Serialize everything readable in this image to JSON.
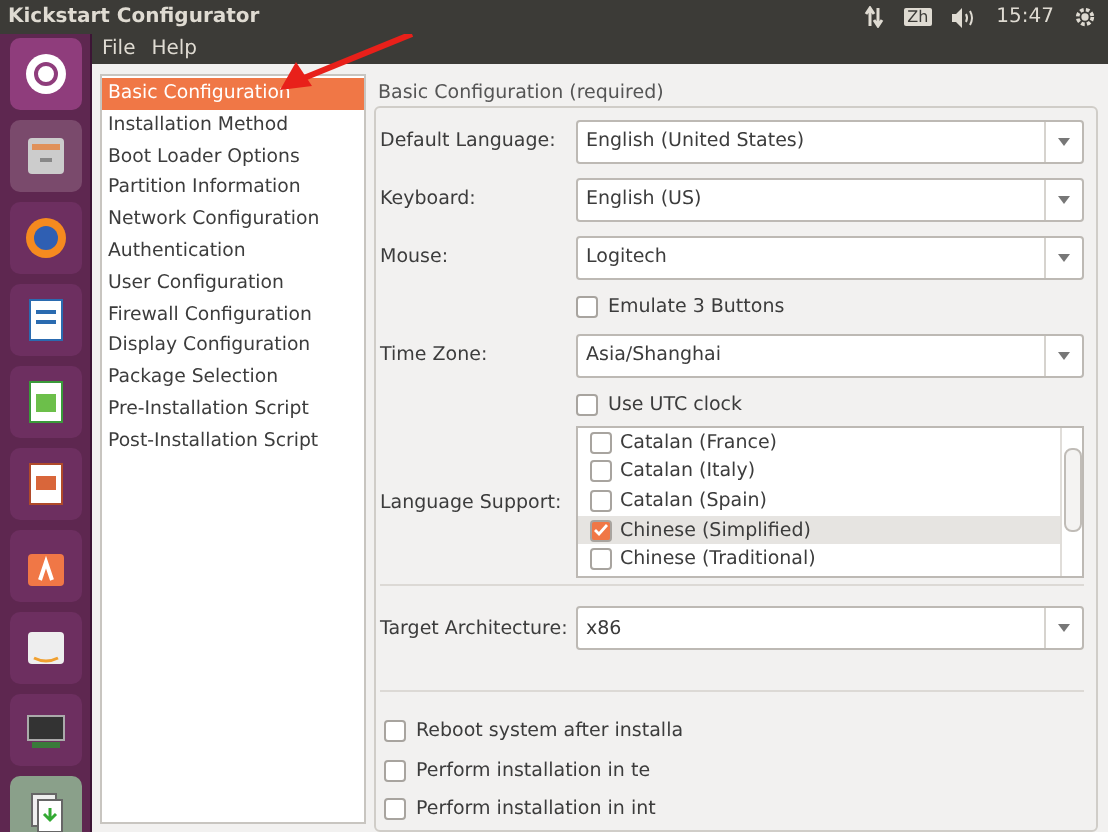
{
  "window": {
    "title": "Kickstart Configurator"
  },
  "panel": {
    "keyboard_layout": "Zh",
    "clock": "15:47"
  },
  "menu": [
    "File",
    "Help"
  ],
  "sidebar": {
    "items": [
      {
        "label": "Basic Configuration",
        "selected": true
      },
      {
        "label": "Installation Method",
        "selected": false
      },
      {
        "label": "Boot Loader Options",
        "selected": false
      },
      {
        "label": "Partition Information",
        "selected": false
      },
      {
        "label": "Network Configuration",
        "selected": false
      },
      {
        "label": "Authentication",
        "selected": false
      },
      {
        "label": "User Configuration",
        "selected": false
      },
      {
        "label": "Firewall Configuration",
        "selected": false
      },
      {
        "label": "Display Configuration",
        "selected": false
      },
      {
        "label": "Package Selection",
        "selected": false
      },
      {
        "label": "Pre-Installation Script",
        "selected": false
      },
      {
        "label": "Post-Installation Script",
        "selected": false
      }
    ]
  },
  "section": {
    "title": "Basic Configuration (required)",
    "fields": [
      {
        "kind": "select",
        "label": "Default Language:",
        "value": "English (United States)"
      },
      {
        "kind": "select",
        "label": "Keyboard:",
        "value": "English (US)"
      },
      {
        "kind": "select",
        "label": "Mouse:",
        "value": "Logitech"
      },
      {
        "kind": "checkbox",
        "label": "Emulate 3 Buttons",
        "checked": false
      },
      {
        "kind": "select",
        "label": "Time Zone:",
        "value": "Asia/Shanghai"
      },
      {
        "kind": "checkbox",
        "label": "Use UTC clock",
        "checked": false
      }
    ],
    "language_support": {
      "label": "Language Support:",
      "items": [
        {
          "label": "Catalan (France)",
          "checked": false,
          "selected": false
        },
        {
          "label": "Catalan (Italy)",
          "checked": false,
          "selected": false
        },
        {
          "label": "Catalan (Spain)",
          "checked": false,
          "selected": false
        },
        {
          "label": "Chinese (Simplified)",
          "checked": true,
          "selected": true
        },
        {
          "label": "Chinese (Traditional)",
          "checked": false,
          "selected": false
        }
      ]
    },
    "target_architecture": {
      "label": "Target Architecture:",
      "value": "x86"
    },
    "options": [
      {
        "label": "Reboot system after installa",
        "checked": false
      },
      {
        "label": "Perform installation in te",
        "checked": false
      },
      {
        "label": "Perform installation in int",
        "checked": false
      }
    ]
  }
}
